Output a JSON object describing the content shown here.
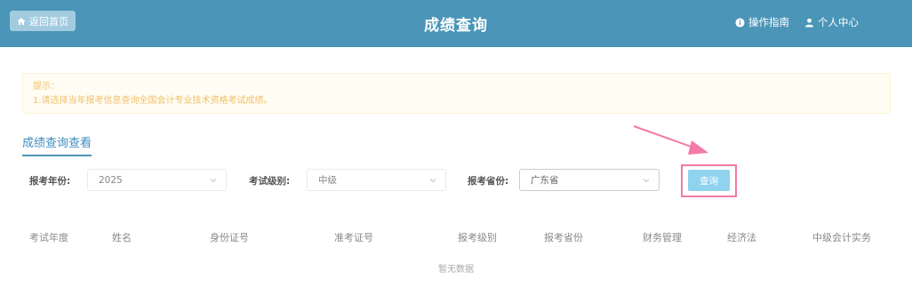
{
  "header": {
    "back_label": "返回首页",
    "title": "成绩查询",
    "guide_label": "操作指南",
    "user_label": "个人中心",
    "bar_color": "#4a95b8"
  },
  "notice": {
    "title": "提示：",
    "line1": "1.请选择当年报考信息查询全国会计专业技术资格考试成绩。"
  },
  "section_tab": "成绩查询查看",
  "form": {
    "year_label": "报考年份:",
    "year_value": "2025",
    "level_label": "考试级别:",
    "level_value": "中级",
    "province_label": "报考省份:",
    "province_value": "广东省",
    "query_label": "查询"
  },
  "table": {
    "columns": [
      "考试年度",
      "姓名",
      "身份证号",
      "准考证号",
      "报考级别",
      "报考省份",
      "财务管理",
      "经济法",
      "中级会计实务"
    ],
    "empty_text": "暂无数据"
  },
  "icons": {
    "home": "home-icon",
    "info": "info-icon",
    "user": "user-icon",
    "chevron": "chevron-down-icon"
  },
  "colors": {
    "accent": "#4a95b8",
    "highlight": "#f27aa5",
    "button": "#8fd3ef",
    "notice_text": "#f1c06b"
  }
}
